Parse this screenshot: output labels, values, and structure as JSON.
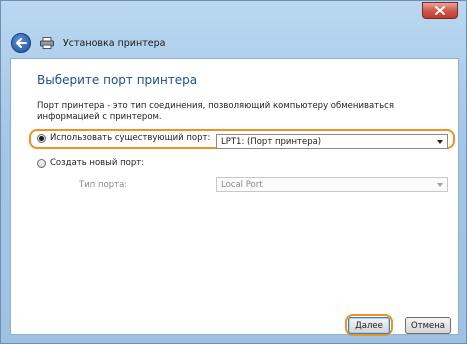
{
  "window": {
    "title": "Установка принтера",
    "icons": {
      "close": "close-icon",
      "back": "back-arrow-icon",
      "printer": "printer-icon"
    },
    "colors": {
      "accent": "#1e4f8f",
      "highlight": "#f29022",
      "close": "#c23a2b"
    }
  },
  "page": {
    "heading": "Выберите порт принтера",
    "description": "Порт принтера - это тип соединения, позволяющий компьютеру обмениваться информацией с принтером."
  },
  "options": {
    "use_existing": {
      "label": "Использовать существующий порт:",
      "selected": true,
      "value": "LPT1: (Порт принтера)"
    },
    "create_new": {
      "label": "Создать новый порт:",
      "selected": false,
      "port_type_label": "Тип порта:",
      "port_type_value": "Local Port"
    }
  },
  "buttons": {
    "next": "Далее",
    "cancel": "Отмена"
  }
}
